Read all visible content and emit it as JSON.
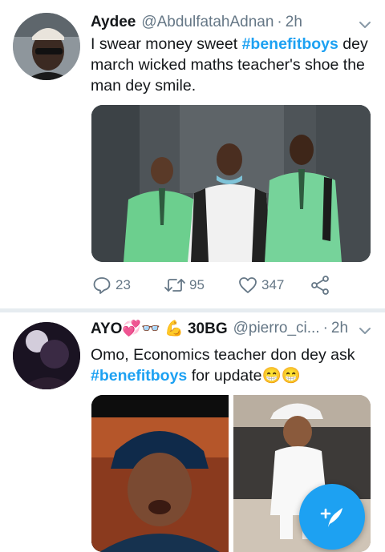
{
  "tweets": [
    {
      "name": "Aydee",
      "handle": "@AbdulfatahAdnan",
      "dot": "·",
      "time": "2h",
      "text_before": "I swear money sweet ",
      "hashtag": "#benefitboys",
      "text_after": " dey march wicked maths teacher's shoe the man dey smile.",
      "replies": "23",
      "retweets": "95",
      "likes": "347"
    },
    {
      "name": "AYO💞👓 💪 30BG",
      "handle": "@pierro_ci...",
      "dot": "·",
      "time": "2h",
      "text_before": "Omo, Economics teacher don dey ask ",
      "hashtag": "#benefitboys",
      "text_after": " for update😁😁"
    }
  ],
  "colors": {
    "accent": "#1da1f2",
    "secondary_text": "#657786",
    "divider": "#e6ecf0"
  },
  "icons": {
    "reply": "reply-icon",
    "retweet": "retweet-icon",
    "like": "heart-icon",
    "share": "share-icon",
    "menu": "chevron-down-icon",
    "compose": "compose-tweet-icon"
  }
}
